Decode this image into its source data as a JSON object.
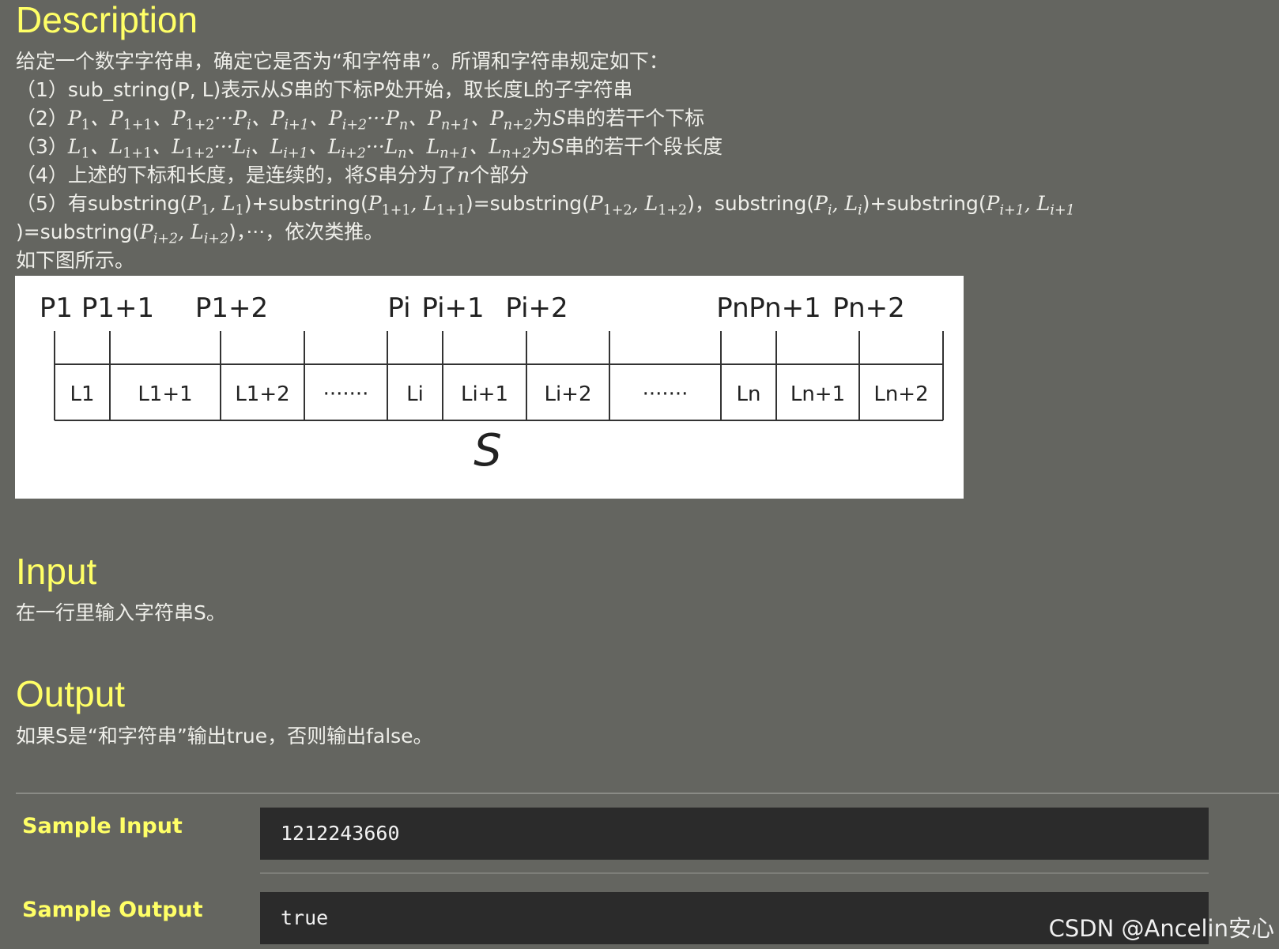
{
  "description": {
    "heading": "Description",
    "intro": "给定一个数字字符串，确定它是否为“和字符串”。所谓和字符串规定如下：",
    "rule1_prefix": "（1）sub_string(P, L)表示从",
    "rule1_suffix": "串的下标P处开始，取长度L的子字符串",
    "rule2_prefix": "（2）",
    "rule2_suffix": "为",
    "rule2_end": "串的若干个下标",
    "rule3_prefix": "（3）",
    "rule3_suffix": "为",
    "rule3_end": "串的若干个段长度",
    "rule4_prefix": "（4）上述的下标和长度，是连续的，将",
    "rule4_mid": "串分为了",
    "rule4_end": "个部分",
    "rule5_prefix": "（5）有",
    "rule5_line2_end": "，依次类推。",
    "figure_caption": "如下图所示。"
  },
  "figure": {
    "p_labels": [
      "P1",
      "P1+1",
      "P1+2",
      "Pi",
      "Pi+1",
      "Pi+2",
      "Pn",
      "Pn+1",
      "Pn+2"
    ],
    "l_labels": [
      "L1",
      "L1+1",
      "L1+2",
      "·······",
      "Li",
      "Li+1",
      "Li+2",
      "·······",
      "Ln",
      "Ln+1",
      "Ln+2"
    ],
    "s_label": "S"
  },
  "input": {
    "heading": "Input",
    "text": "在一行里输入字符串S。"
  },
  "output": {
    "heading": "Output",
    "text": "如果S是“和字符串”输出true，否则输出false。"
  },
  "samples": {
    "input_label": "Sample Input",
    "input_value": "1212243660",
    "output_label": "Sample Output",
    "output_value": "true"
  },
  "watermark": "CSDN @Ancelin安心"
}
